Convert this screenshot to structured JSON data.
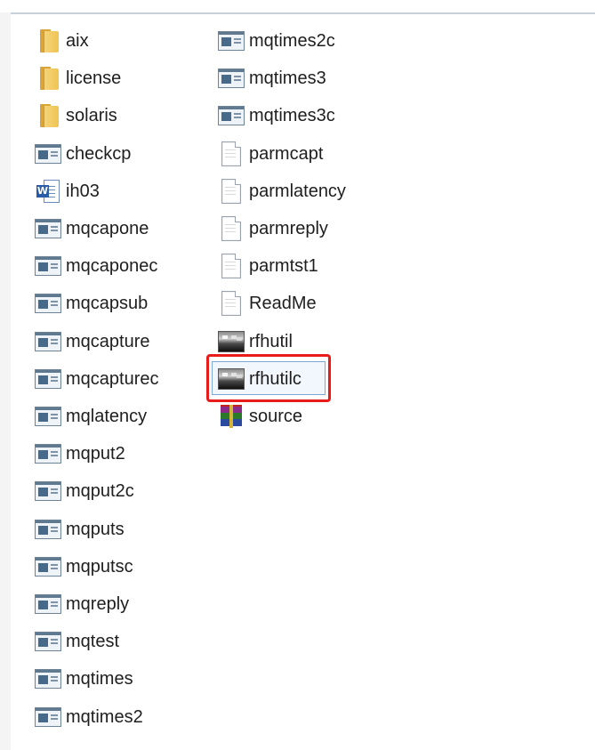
{
  "explorer": {
    "column1": [
      {
        "name": "aix",
        "icon": "folder-icon",
        "type": "folder"
      },
      {
        "name": "license",
        "icon": "folder-icon",
        "type": "folder"
      },
      {
        "name": "solaris",
        "icon": "folder-icon",
        "type": "folder"
      },
      {
        "name": "checkcp",
        "icon": "exe-icon",
        "type": "exe"
      },
      {
        "name": "ih03",
        "icon": "word-doc-icon",
        "type": "doc"
      },
      {
        "name": "mqcapone",
        "icon": "exe-icon",
        "type": "exe"
      },
      {
        "name": "mqcaponec",
        "icon": "exe-icon",
        "type": "exe"
      },
      {
        "name": "mqcapsub",
        "icon": "exe-icon",
        "type": "exe"
      },
      {
        "name": "mqcapture",
        "icon": "exe-icon",
        "type": "exe"
      },
      {
        "name": "mqcapturec",
        "icon": "exe-icon",
        "type": "exe"
      },
      {
        "name": "mqlatency",
        "icon": "exe-icon",
        "type": "exe"
      },
      {
        "name": "mqput2",
        "icon": "exe-icon",
        "type": "exe"
      },
      {
        "name": "mqput2c",
        "icon": "exe-icon",
        "type": "exe"
      },
      {
        "name": "mqputs",
        "icon": "exe-icon",
        "type": "exe"
      },
      {
        "name": "mqputsc",
        "icon": "exe-icon",
        "type": "exe"
      },
      {
        "name": "mqreply",
        "icon": "exe-icon",
        "type": "exe"
      },
      {
        "name": "mqtest",
        "icon": "exe-icon",
        "type": "exe"
      },
      {
        "name": "mqtimes",
        "icon": "exe-icon",
        "type": "exe"
      },
      {
        "name": "mqtimes2",
        "icon": "exe-icon",
        "type": "exe"
      }
    ],
    "column2": [
      {
        "name": "mqtimes2c",
        "icon": "exe-icon",
        "type": "exe"
      },
      {
        "name": "mqtimes3",
        "icon": "exe-icon",
        "type": "exe"
      },
      {
        "name": "mqtimes3c",
        "icon": "exe-icon",
        "type": "exe"
      },
      {
        "name": "parmcapt",
        "icon": "text-file-icon",
        "type": "txt"
      },
      {
        "name": "parmlatency",
        "icon": "text-file-icon",
        "type": "txt"
      },
      {
        "name": "parmreply",
        "icon": "text-file-icon",
        "type": "txt"
      },
      {
        "name": "parmtst1",
        "icon": "text-file-icon",
        "type": "txt"
      },
      {
        "name": "ReadMe",
        "icon": "text-file-icon",
        "type": "txt"
      },
      {
        "name": "rfhutil",
        "icon": "app-icon",
        "type": "app"
      },
      {
        "name": "rfhutilc",
        "icon": "app-icon",
        "type": "app",
        "selected": true
      },
      {
        "name": "source",
        "icon": "archive-icon",
        "type": "arc"
      }
    ],
    "highlight_color": "#ea1b1b",
    "selection_color": "#7fa6d8"
  }
}
